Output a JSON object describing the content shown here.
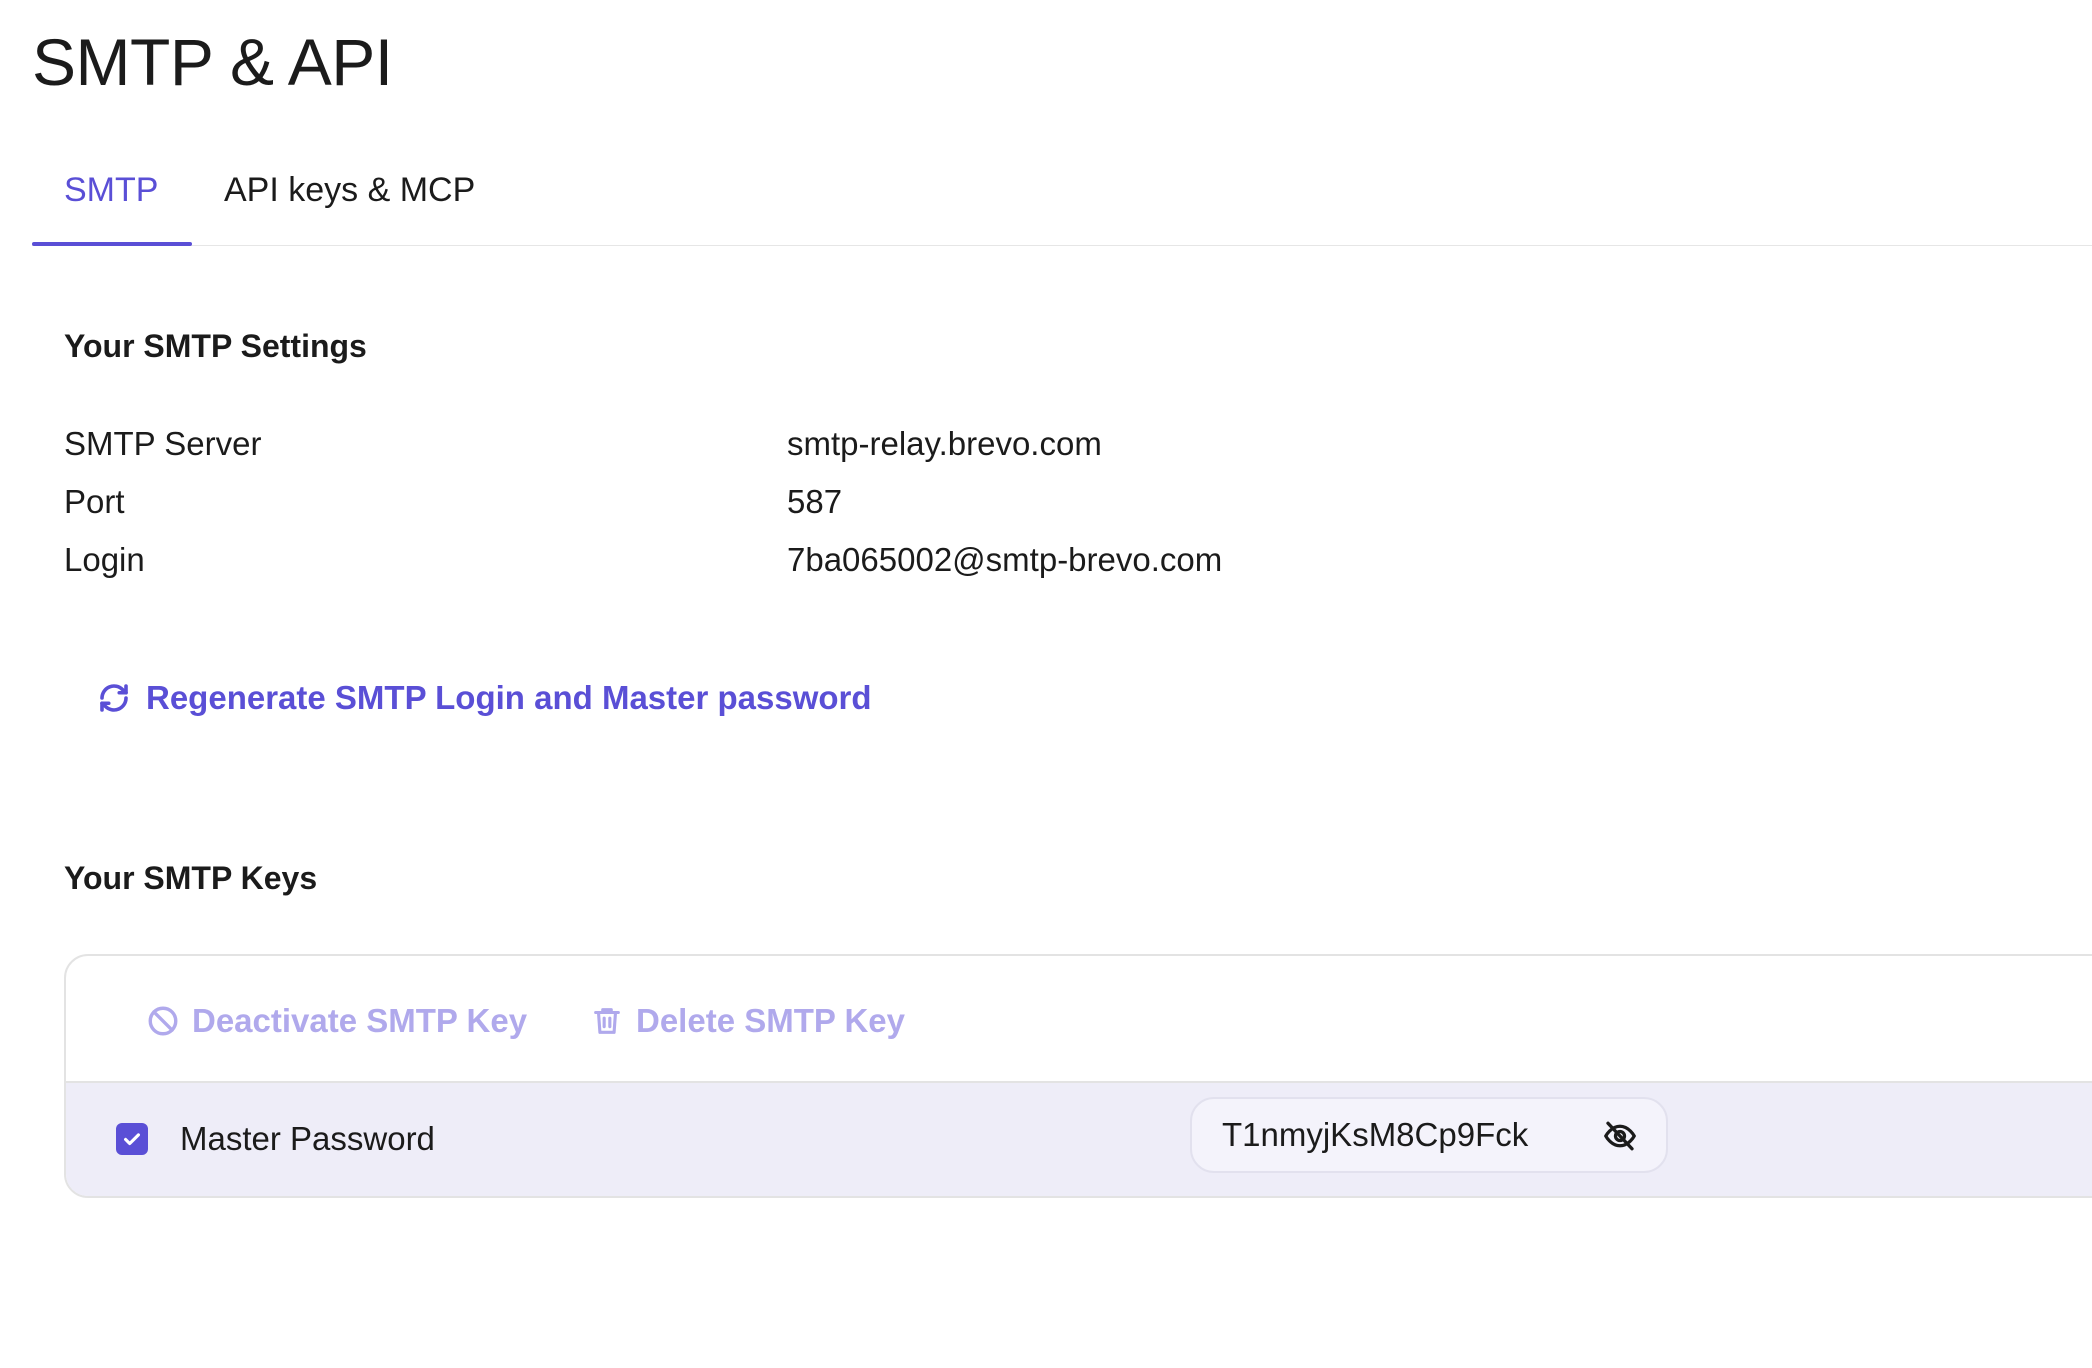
{
  "page": {
    "title": "SMTP & API"
  },
  "tabs": [
    {
      "label": "SMTP",
      "active": true
    },
    {
      "label": "API keys & MCP",
      "active": false
    }
  ],
  "settings": {
    "heading": "Your SMTP Settings",
    "rows": [
      {
        "label": "SMTP Server",
        "value": "smtp-relay.brevo.com"
      },
      {
        "label": "Port",
        "value": "587"
      },
      {
        "label": "Login",
        "value": "7ba065002@smtp-brevo.com"
      }
    ],
    "regenerate_label": "Regenerate SMTP Login and Master password",
    "regenerate_icon": "refresh-icon"
  },
  "keys": {
    "heading": "Your SMTP Keys",
    "toolbar": {
      "deactivate_label": "Deactivate SMTP Key",
      "deactivate_icon": "block-icon",
      "delete_label": "Delete SMTP Key",
      "delete_icon": "trash-icon"
    },
    "rows": [
      {
        "name": "Master Password",
        "value": "T1nmyjKsM8Cp9Fck",
        "checked": true,
        "visibility_icon": "eye-off-icon"
      }
    ]
  },
  "colors": {
    "accent": "#5a4fd6",
    "accent_disabled": "#b0a9ec",
    "row_selected_bg": "#eeedf8"
  }
}
